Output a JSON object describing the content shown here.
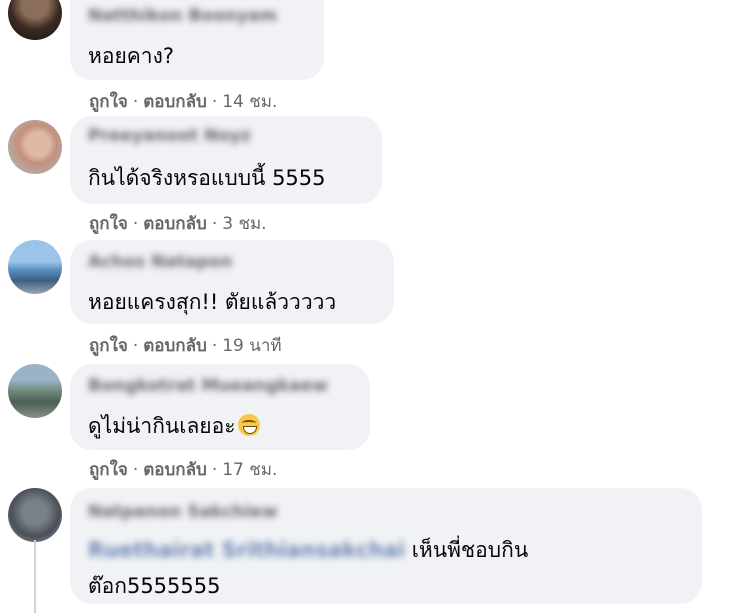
{
  "actions": {
    "like": "ถูกใจ",
    "reply": "ตอบกลับ",
    "sep": "·"
  },
  "comments": [
    {
      "author": "Natthikon Boonyam",
      "text": "หอยคาง?",
      "time": "14 ชม."
    },
    {
      "author": "Preeyanoot Noyz",
      "text": "กินได้จริงหรอแบบนี้ 5555",
      "time": "3 ชม."
    },
    {
      "author": "Achos Natapon",
      "text": "หอยแครงสุก!! ตัยแล้ววววว",
      "time": "19 นาที"
    },
    {
      "author": "Bongkotrat Mueangkaew",
      "text": "ดูไม่น่ากินเลยอะ",
      "time": "17 ชม."
    },
    {
      "author": "Natpanon Sakchiew",
      "mention": "Ruethairat Srithiansakchai",
      "text": "เห็นพี่ชอบกิน",
      "text2": "ต๊อก5555555"
    }
  ],
  "emoji": "grinning-face-with-sweat-emoji"
}
